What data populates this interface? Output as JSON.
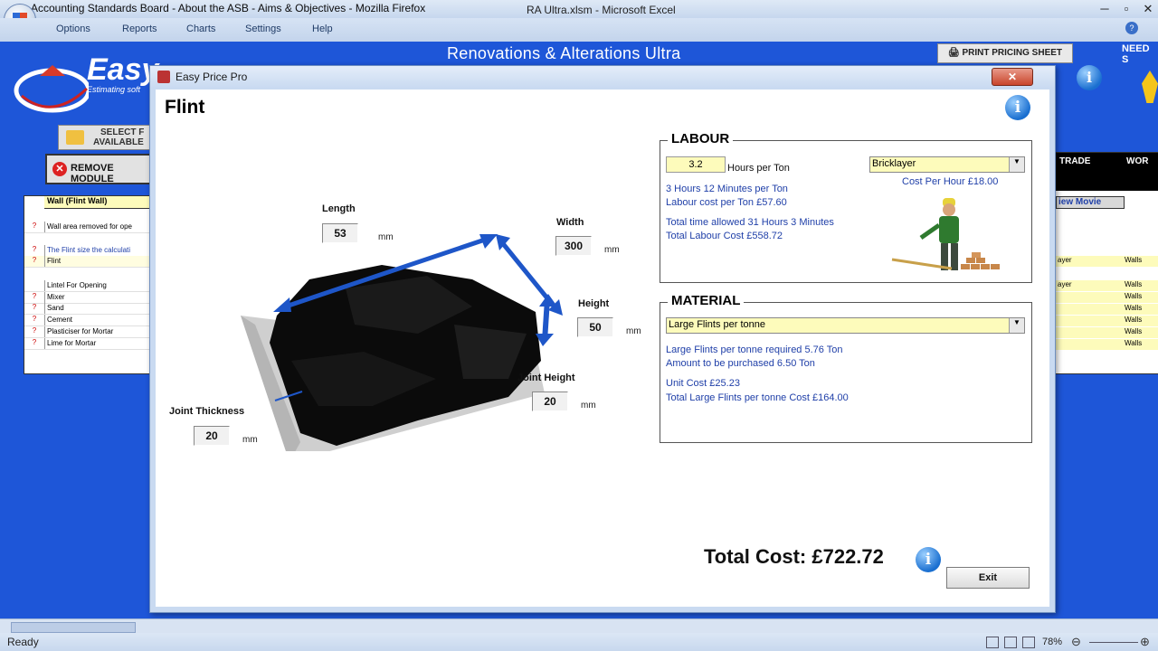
{
  "window": {
    "browser_tab_text": "Accounting Standards Board - About the ASB - Aims & Objectives - Mozilla Firefox",
    "title": "RA Ultra.xlsm - Microsoft Excel"
  },
  "menu": {
    "items": [
      "Options",
      "Reports",
      "Charts",
      "Settings",
      "Help"
    ]
  },
  "sheet": {
    "app_title": "Renovations & Alterations Ultra",
    "print_button": "PRINT PRICING SHEET",
    "need_text": "NEED S",
    "logo_text": "Easy",
    "logo_subtext": "Estimating soft",
    "select_button_line1": "SELECT F",
    "select_button_line2": "AVAILABLE",
    "remove_module_button": "REMOVE MODULE",
    "left_table": {
      "header": "Wall (Flint Wall)",
      "rows": [
        {
          "q": "?",
          "label": "Wall area removed for ope"
        },
        {
          "q": "?",
          "label": "The Flint size the calculati"
        },
        {
          "q": "?",
          "label": "Flint"
        },
        {
          "q": "",
          "label": "Lintel For Opening"
        },
        {
          "q": "?",
          "label": "Mixer"
        },
        {
          "q": "?",
          "label": "Sand"
        },
        {
          "q": "?",
          "label": "Cement"
        },
        {
          "q": "?",
          "label": "Plasticiser for Mortar"
        },
        {
          "q": "?",
          "label": "Lime for Mortar"
        }
      ]
    },
    "right_table": {
      "header_trade": "TRADE",
      "header_wor": "WOR",
      "view_movie": "iew Movie",
      "rows": [
        {
          "trade": "ayer",
          "wor": "Walls"
        },
        {
          "trade": "ayer",
          "wor": "Walls"
        },
        {
          "trade": "",
          "wor": "Walls"
        },
        {
          "trade": "",
          "wor": "Walls"
        },
        {
          "trade": "",
          "wor": "Walls"
        },
        {
          "trade": "",
          "wor": "Walls"
        },
        {
          "trade": "",
          "wor": "Walls"
        }
      ]
    }
  },
  "dialog": {
    "title": "Easy Price Pro",
    "heading": "Flint",
    "dimensions": {
      "length_label": "Length",
      "length_value": "53",
      "width_label": "Width",
      "width_value": "300",
      "height_label": "Height",
      "height_value": "50",
      "joint_height_label": "Joint Height",
      "joint_height_value": "20",
      "joint_thickness_label": "Joint Thickness",
      "joint_thickness_value": "20",
      "unit": "mm"
    },
    "labour": {
      "header": "LABOUR",
      "hours_value": "3.2",
      "hours_label": "Hours per Ton",
      "trade_select": "Bricklayer",
      "cost_per_hour": "Cost Per Hour £18.00",
      "line1": "3 Hours 12 Minutes per Ton",
      "line2": "Labour cost per Ton  £57.60",
      "line3": "Total time allowed 31 Hours 3 Minutes",
      "line4": "Total Labour Cost £558.72"
    },
    "material": {
      "header": "MATERIAL",
      "select": "Large Flints per tonne",
      "line1": "Large Flints per tonne required 5.76 Ton",
      "line2": "Amount to be purchased 6.50 Ton",
      "line3": "Unit Cost £25.23",
      "line4": "Total Large Flints per tonne Cost £164.00"
    },
    "total_cost": "Total Cost: £722.72",
    "exit_button": "Exit"
  },
  "status": {
    "text": "Ready",
    "zoom": "78%"
  },
  "colors": {
    "sheet_bg": "#1e56d8",
    "panel_text_blue": "#1f3fa8",
    "input_yellow": "#fdfbbb"
  }
}
